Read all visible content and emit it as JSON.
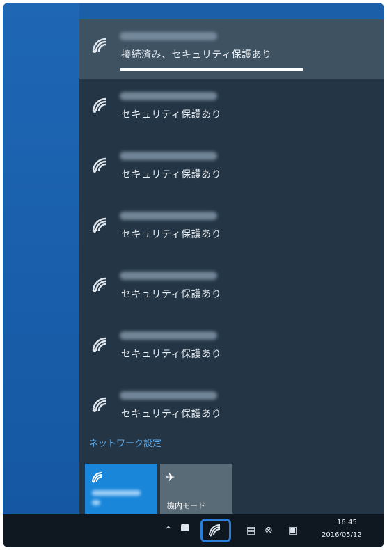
{
  "networks": [
    {
      "status": "接続済み、セキュリティ保護あり",
      "connected": true
    },
    {
      "status": "セキュリティ保護あり",
      "connected": false
    },
    {
      "status": "セキュリティ保護あり",
      "connected": false
    },
    {
      "status": "セキュリティ保護あり",
      "connected": false
    },
    {
      "status": "セキュリティ保護あり",
      "connected": false
    },
    {
      "status": "セキュリティ保護あり",
      "connected": false
    },
    {
      "status": "セキュリティ保護あり",
      "connected": false
    }
  ],
  "settings_link": "ネットワーク設定",
  "quick_actions": {
    "wifi_tile": {
      "icon": "wifi-icon"
    },
    "airplane_tile": {
      "label": "機内モード",
      "icon": "airplane-icon"
    }
  },
  "taskbar": {
    "time": "16:45",
    "date": "2016/05/12",
    "icons": [
      "chevron-up-icon",
      "battery-icon",
      "wifi-icon",
      "message-icon",
      "close-circle-icon",
      "notification-icon"
    ]
  },
  "colors": {
    "accent": "#1a86d9",
    "flyout": "#243645",
    "taskbar": "#0f1720",
    "highlight": "#2b7fd8"
  }
}
